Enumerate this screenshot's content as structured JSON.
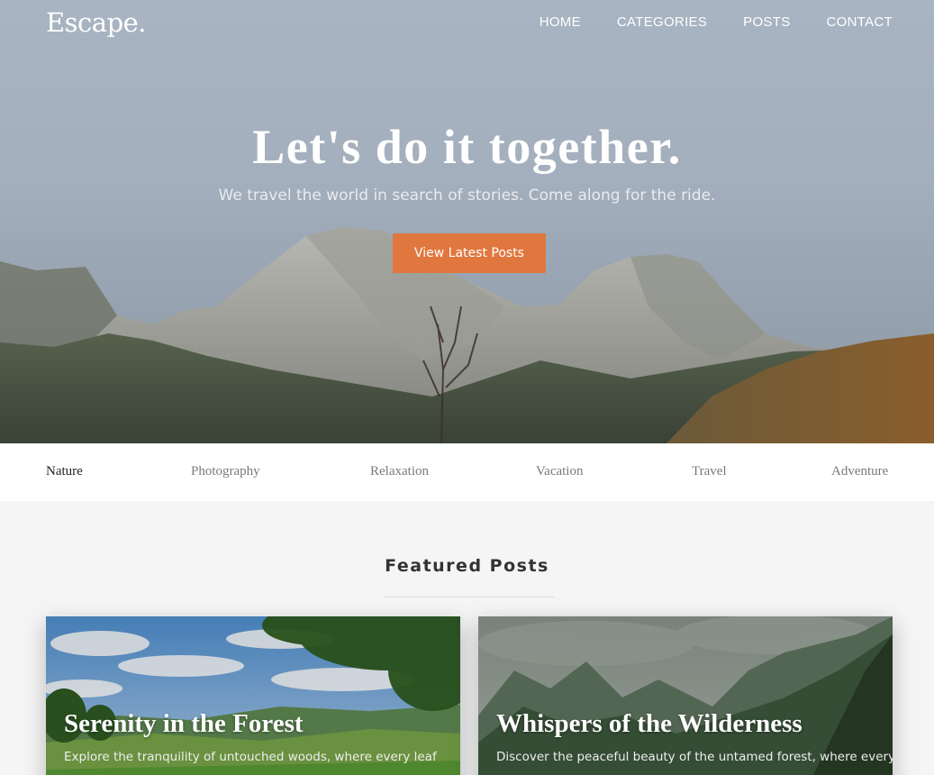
{
  "site": {
    "logo": "Escape."
  },
  "nav": {
    "items": [
      "HOME",
      "CATEGORIES",
      "POSTS",
      "CONTACT"
    ]
  },
  "hero": {
    "headline": "Let's do it together.",
    "tagline": "We travel the world in search of stories. Come along for the ride.",
    "cta_label": "View Latest Posts",
    "cta_color": "#e0773f"
  },
  "categories": {
    "items": [
      "Nature",
      "Photography",
      "Relaxation",
      "Vacation",
      "Travel",
      "Adventure"
    ],
    "active": "Nature"
  },
  "featured": {
    "title": "Featured Posts",
    "posts": [
      {
        "title": "Serenity in the Forest",
        "excerpt": "Explore the tranquility of untouched woods, where every leaf"
      },
      {
        "title": "Whispers of the Wilderness",
        "excerpt": "Discover the peaceful beauty of the untamed forest, where every"
      }
    ]
  }
}
